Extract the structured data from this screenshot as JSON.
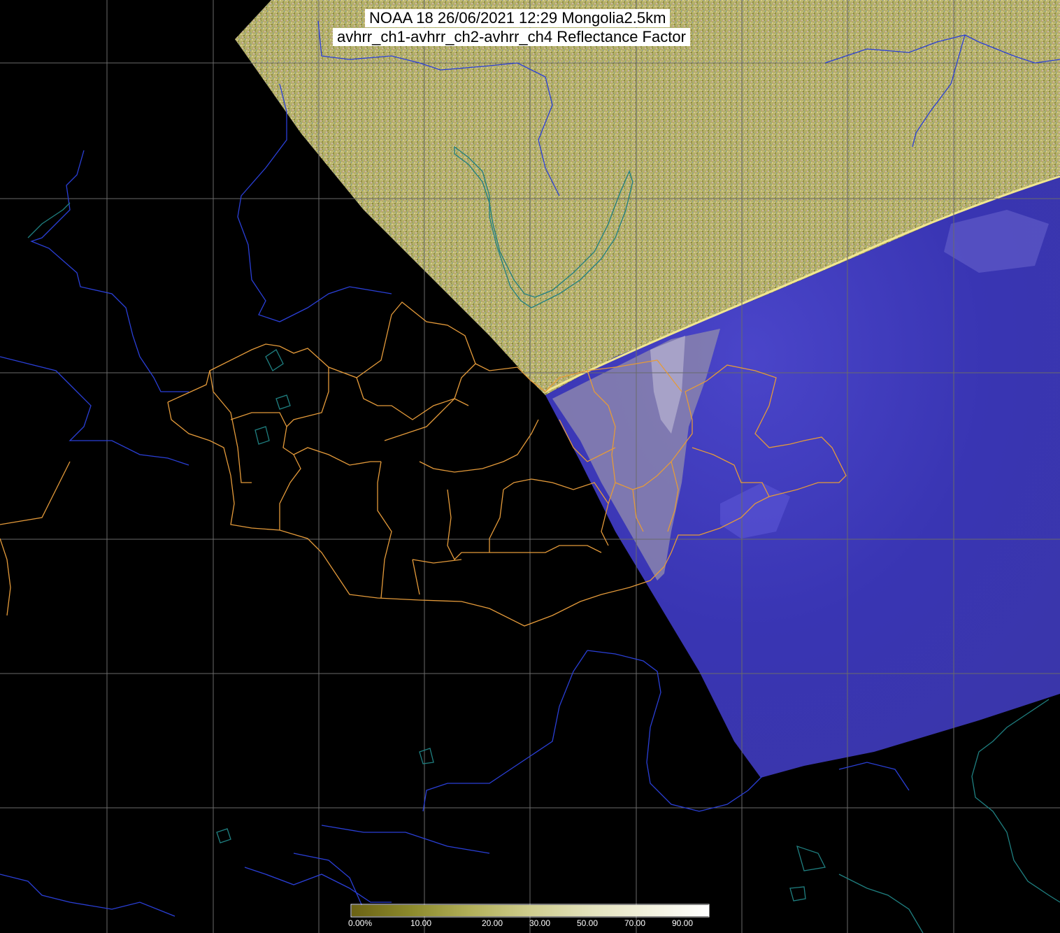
{
  "title": {
    "line1": "NOAA 18 26/06/2021 12:29 Mongolia2.5km",
    "line2": "avhrr_ch1-avhrr_ch2-avhrr_ch4 Reflectance Factor"
  },
  "colorbar": {
    "tick_labels": [
      "0.00%",
      "10.00",
      "20.00",
      "30.00",
      "50.00",
      "70.00",
      "90.00"
    ],
    "colors": [
      "#6b6214",
      "#8c8a2c",
      "#b2b05a",
      "#cfcd8e",
      "#e3e2bc",
      "#f2f1dd",
      "#ffffff"
    ]
  },
  "colors": {
    "background": "#000000",
    "noise_swath": "#b7b36a",
    "visible_swath": "#3d38b5",
    "cloud_overlay": "#8c86b0",
    "grid": "#6a6a6a",
    "province_borders": "#e49a3a",
    "rivers": "#2a3fd6",
    "coastlines": "#1f7f80"
  },
  "layers": [
    "lat-lon-grid",
    "satellite-swath",
    "province-borders",
    "rivers",
    "coastlines",
    "colorbar",
    "title"
  ]
}
